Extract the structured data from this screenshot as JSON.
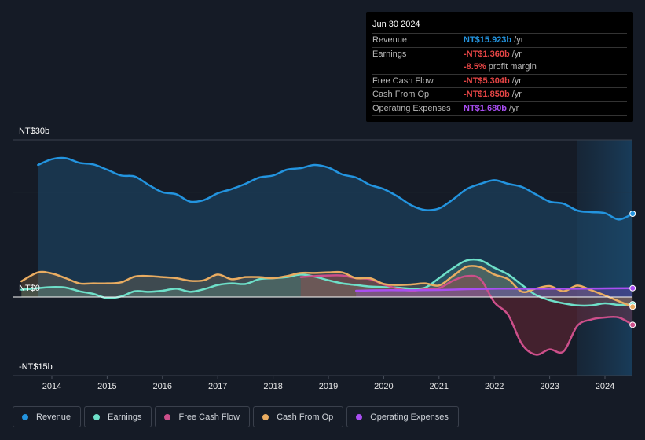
{
  "tooltip": {
    "date": "Jun 30 2024",
    "rows": [
      {
        "label": "Revenue",
        "value": "NT$15.923b",
        "unit": "/yr",
        "color": "#2394df"
      },
      {
        "label": "Earnings",
        "value": "-NT$1.360b",
        "unit": "/yr",
        "color": "#e64545"
      },
      {
        "label": "",
        "value": "-8.5%",
        "unit": "profit margin",
        "color": "#e64545"
      },
      {
        "label": "Free Cash Flow",
        "value": "-NT$5.304b",
        "unit": "/yr",
        "color": "#e64545"
      },
      {
        "label": "Cash From Op",
        "value": "-NT$1.850b",
        "unit": "/yr",
        "color": "#e64545"
      },
      {
        "label": "Operating Expenses",
        "value": "NT$1.680b",
        "unit": "/yr",
        "color": "#a94ef2"
      }
    ]
  },
  "legend": [
    {
      "label": "Revenue",
      "color": "#2394df"
    },
    {
      "label": "Earnings",
      "color": "#6ee0c9"
    },
    {
      "label": "Free Cash Flow",
      "color": "#cc4f8a"
    },
    {
      "label": "Cash From Op",
      "color": "#e9ac61"
    },
    {
      "label": "Operating Expenses",
      "color": "#a94ef2"
    }
  ],
  "chart_data": {
    "type": "area",
    "title": "",
    "xlabel": "",
    "ylabel": "",
    "y_tick_labels": [
      "NT$30b",
      "NT$0",
      "-NT$15b"
    ],
    "y_ticks": [
      30,
      0,
      -15
    ],
    "ylim": [
      -15,
      30
    ],
    "xlim": [
      2013.45,
      2024.5
    ],
    "x_ticks": [
      2014,
      2015,
      2016,
      2017,
      2018,
      2019,
      2020,
      2021,
      2022,
      2023,
      2024
    ],
    "x_tick_labels": [
      "2014",
      "2015",
      "2016",
      "2017",
      "2018",
      "2019",
      "2020",
      "2021",
      "2022",
      "2023",
      "2024"
    ],
    "grid": true,
    "highlight_from": 2023.5,
    "legend_position": "bottom",
    "series": [
      {
        "name": "Revenue",
        "color": "#2394df",
        "x": [
          2013.75,
          2014.0,
          2014.25,
          2014.5,
          2014.75,
          2015.0,
          2015.25,
          2015.5,
          2015.75,
          2016.0,
          2016.25,
          2016.5,
          2016.75,
          2017.0,
          2017.25,
          2017.5,
          2017.75,
          2018.0,
          2018.25,
          2018.5,
          2018.75,
          2019.0,
          2019.25,
          2019.5,
          2019.75,
          2020.0,
          2020.25,
          2020.5,
          2020.75,
          2021.0,
          2021.25,
          2021.5,
          2021.75,
          2022.0,
          2022.25,
          2022.5,
          2022.75,
          2023.0,
          2023.25,
          2023.5,
          2023.75,
          2024.0,
          2024.25,
          2024.5
        ],
        "values": [
          25.2,
          26.3,
          26.5,
          25.6,
          25.3,
          24.3,
          23.2,
          23.0,
          21.4,
          20.0,
          19.6,
          18.2,
          18.5,
          19.8,
          20.6,
          21.6,
          22.8,
          23.2,
          24.3,
          24.6,
          25.2,
          24.7,
          23.4,
          22.8,
          21.4,
          20.6,
          19.2,
          17.5,
          16.6,
          16.9,
          18.6,
          20.6,
          21.6,
          22.3,
          21.6,
          21.0,
          19.6,
          18.2,
          17.8,
          16.5,
          16.2,
          16.0,
          14.8,
          15.9
        ]
      },
      {
        "name": "Earnings",
        "color": "#6ee0c9",
        "x": [
          2013.45,
          2013.75,
          2014.0,
          2014.25,
          2014.5,
          2014.75,
          2015.0,
          2015.25,
          2015.5,
          2015.75,
          2016.0,
          2016.25,
          2016.5,
          2016.75,
          2017.0,
          2017.25,
          2017.5,
          2017.75,
          2018.0,
          2018.25,
          2018.5,
          2018.75,
          2019.0,
          2019.25,
          2019.5,
          2019.75,
          2020.0,
          2020.25,
          2020.5,
          2020.75,
          2021.0,
          2021.25,
          2021.5,
          2021.75,
          2022.0,
          2022.25,
          2022.5,
          2022.75,
          2023.0,
          2023.25,
          2023.5,
          2023.75,
          2024.0,
          2024.25,
          2024.5
        ],
        "values": [
          1.4,
          1.7,
          1.9,
          1.8,
          1.1,
          0.6,
          -0.2,
          0.1,
          1.1,
          1.0,
          1.2,
          1.6,
          1.0,
          1.5,
          2.3,
          2.6,
          2.5,
          3.4,
          3.6,
          3.8,
          4.3,
          3.9,
          3.2,
          2.6,
          2.3,
          2.0,
          1.9,
          1.8,
          1.6,
          1.8,
          3.6,
          5.5,
          7.0,
          7.0,
          5.6,
          4.3,
          2.3,
          0.4,
          -0.6,
          -1.2,
          -1.6,
          -1.6,
          -1.2,
          -1.5,
          -1.36
        ]
      },
      {
        "name": "Free Cash Flow",
        "color": "#cc4f8a",
        "x": [
          2018.5,
          2018.75,
          2019.0,
          2019.25,
          2019.5,
          2019.75,
          2020.0,
          2020.25,
          2020.5,
          2020.75,
          2021.0,
          2021.25,
          2021.5,
          2021.75,
          2022.0,
          2022.25,
          2022.5,
          2022.75,
          2023.0,
          2023.25,
          2023.5,
          2023.75,
          2024.0,
          2024.25,
          2024.5
        ],
        "values": [
          3.8,
          4.0,
          4.1,
          4.1,
          3.6,
          3.4,
          2.4,
          1.6,
          1.2,
          1.5,
          1.7,
          3.1,
          4.0,
          3.4,
          -1.0,
          -3.4,
          -9.0,
          -11.0,
          -10.0,
          -10.4,
          -5.5,
          -4.3,
          -3.9,
          -3.9,
          -5.3
        ]
      },
      {
        "name": "Cash From Op",
        "color": "#e9ac61",
        "x": [
          2013.45,
          2013.75,
          2014.0,
          2014.25,
          2014.5,
          2014.75,
          2015.0,
          2015.25,
          2015.5,
          2015.75,
          2016.0,
          2016.25,
          2016.5,
          2016.75,
          2017.0,
          2017.25,
          2017.5,
          2017.75,
          2018.0,
          2018.25,
          2018.5,
          2018.75,
          2019.0,
          2019.25,
          2019.5,
          2019.75,
          2020.0,
          2020.25,
          2020.5,
          2020.75,
          2021.0,
          2021.25,
          2021.5,
          2021.75,
          2022.0,
          2022.25,
          2022.5,
          2022.75,
          2023.0,
          2023.25,
          2023.5,
          2023.75,
          2024.0,
          2024.25,
          2024.5
        ],
        "values": [
          3.0,
          4.7,
          4.5,
          3.6,
          2.6,
          2.6,
          2.6,
          2.8,
          3.9,
          4.0,
          3.8,
          3.6,
          3.1,
          3.2,
          4.3,
          3.4,
          3.8,
          3.8,
          3.6,
          4.0,
          4.6,
          4.6,
          4.7,
          4.7,
          3.6,
          3.6,
          2.5,
          2.3,
          2.4,
          2.6,
          2.2,
          4.0,
          5.8,
          5.7,
          4.3,
          3.4,
          1.0,
          1.6,
          2.1,
          1.1,
          2.2,
          1.3,
          0.3,
          -0.8,
          -1.85
        ]
      },
      {
        "name": "Operating Expenses",
        "color": "#a94ef2",
        "x": [
          2019.5,
          2020.0,
          2020.5,
          2021.0,
          2021.5,
          2022.0,
          2022.5,
          2023.0,
          2023.5,
          2024.0,
          2024.5
        ],
        "values": [
          1.2,
          1.3,
          1.3,
          1.35,
          1.5,
          1.6,
          1.6,
          1.6,
          1.6,
          1.65,
          1.68
        ]
      }
    ]
  }
}
